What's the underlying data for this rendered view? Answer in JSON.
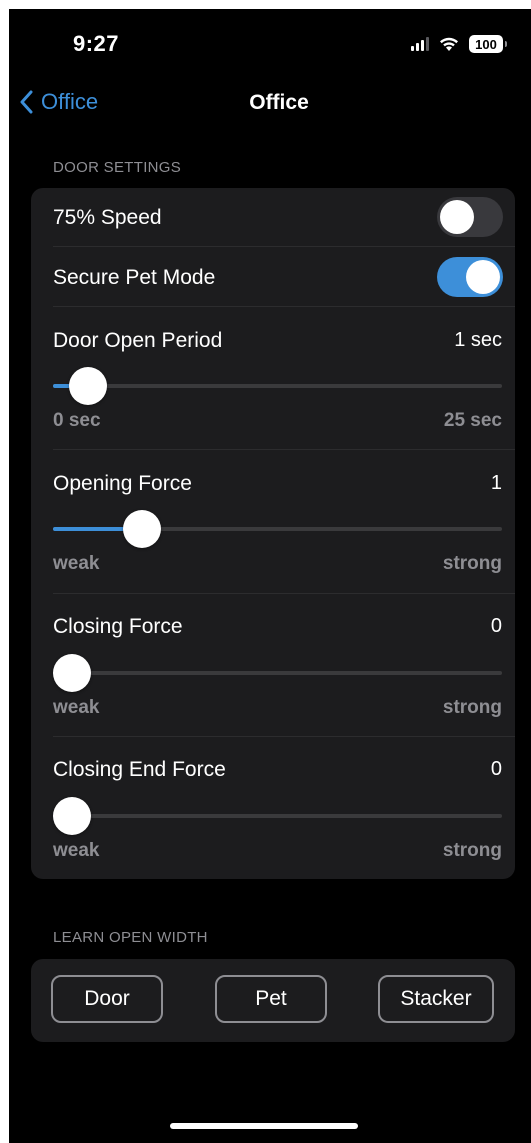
{
  "status_bar": {
    "time": "9:27",
    "battery": "100"
  },
  "nav": {
    "back_label": "Office",
    "title": "Office"
  },
  "door_settings": {
    "header": "DOOR SETTINGS",
    "speed_75": {
      "label": "75% Speed",
      "on": false
    },
    "secure_pet_mode": {
      "label": "Secure Pet Mode",
      "on": true
    },
    "door_open_period": {
      "label": "Door Open Period",
      "value": "1 sec",
      "min_label": "0 sec",
      "max_label": "25 sec",
      "level": 0.04
    },
    "opening_force": {
      "label": "Opening Force",
      "value": "1",
      "min_label": "weak",
      "max_label": "strong",
      "level": 0.17
    },
    "closing_force": {
      "label": "Closing Force",
      "value": "0",
      "min_label": "weak",
      "max_label": "strong",
      "level": 0
    },
    "closing_end_force": {
      "label": "Closing End Force",
      "value": "0",
      "min_label": "weak",
      "max_label": "strong",
      "level": 0
    }
  },
  "learn_open_width": {
    "header": "LEARN OPEN WIDTH",
    "buttons": [
      "Door",
      "Pet",
      "Stacker"
    ]
  },
  "colors": {
    "accent": "#3d8fd9",
    "background": "#000000",
    "card": "#1c1c1e",
    "secondary_text": "#8e8e93"
  }
}
